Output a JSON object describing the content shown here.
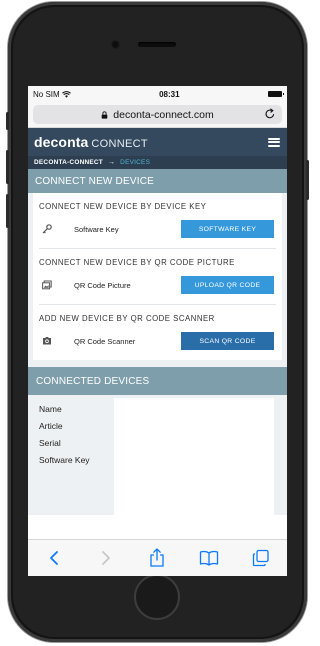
{
  "status_bar": {
    "carrier": "No SIM",
    "time": "08:31"
  },
  "browser": {
    "url": "deconta-connect.com"
  },
  "app": {
    "logo_bold": "deconta",
    "logo_light": "CONNECT"
  },
  "breadcrumb": {
    "root": "DECONTA-CONNECT",
    "separator": "→",
    "current": "DEVICES"
  },
  "connect_section": {
    "title": "CONNECT NEW DEVICE",
    "blocks": [
      {
        "title": "CONNECT NEW DEVICE BY DEVICE KEY",
        "icon": "key-icon",
        "label": "Software Key",
        "button": "SOFTWARE KEY"
      },
      {
        "title": "CONNECT NEW DEVICE BY QR CODE PICTURE",
        "icon": "picture-icon",
        "label": "QR Code Picture",
        "button": "UPLOAD QR CODE"
      },
      {
        "title": "ADD NEW DEVICE BY QR CODE SCANNER",
        "icon": "camera-icon",
        "label": "QR Code Scanner",
        "button": "SCAN QR CODE"
      }
    ]
  },
  "connected_section": {
    "title": "CONNECTED DEVICES",
    "fields": [
      "Name",
      "Article",
      "Serial",
      "Software Key"
    ]
  },
  "colors": {
    "header_bg": "#34495e",
    "breadcrumb_bg": "#2c3e50",
    "section_bg": "#7f9eab",
    "button_blue": "#3498db",
    "button_dark_blue": "#2a6ea9",
    "toolbar_active": "#0a7aff"
  }
}
